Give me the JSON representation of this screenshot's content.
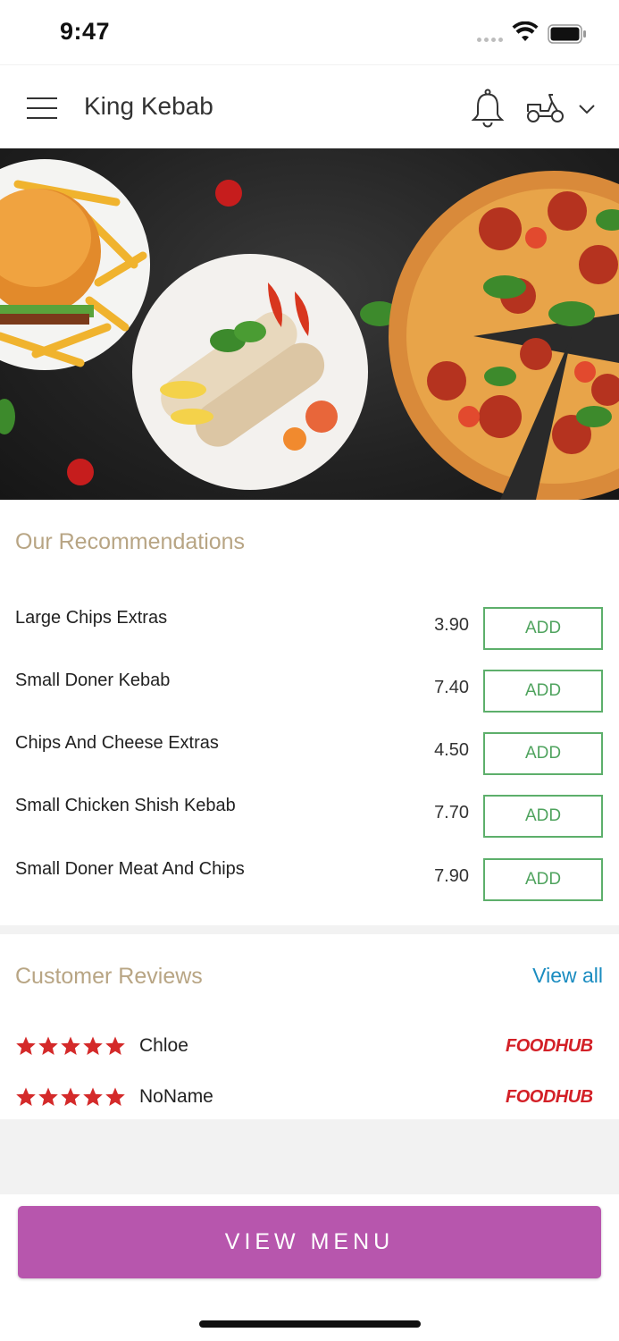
{
  "status_bar": {
    "time": "9:47"
  },
  "header": {
    "store_name": "King Kebab",
    "menu_icon": "hamburger-menu-icon",
    "bell_icon": "bell-icon",
    "delivery_icon": "scooter-icon",
    "chevron_icon": "chevron-down-icon"
  },
  "recommendations": {
    "title": "Our Recommendations",
    "items": [
      {
        "name": "Large Chips Extras",
        "price": "3.90",
        "button": "ADD"
      },
      {
        "name": "Small Doner Kebab",
        "price": "7.40",
        "button": "ADD"
      },
      {
        "name": "Chips And Cheese Extras",
        "price": "4.50",
        "button": "ADD"
      },
      {
        "name": "Small Chicken Shish Kebab",
        "price": "7.70",
        "button": "ADD"
      },
      {
        "name": "Small Doner Meat And Chips",
        "price": "7.90",
        "button": "ADD"
      }
    ]
  },
  "reviews": {
    "title": "Customer Reviews",
    "view_all": "View all",
    "items": [
      {
        "name": "Chloe",
        "rating": 5,
        "source": "FOODHUB"
      },
      {
        "name": "NoName",
        "rating": 5,
        "source": "FOODHUB"
      }
    ]
  },
  "footer": {
    "view_menu": "VIEW MENU"
  },
  "colors": {
    "accent_title": "#b8a584",
    "add_green": "#5daf6b",
    "link_blue": "#1a8cc0",
    "star_red": "#d42a2a",
    "brand_purple": "#b756ad",
    "foodhub_red": "#d32027"
  }
}
